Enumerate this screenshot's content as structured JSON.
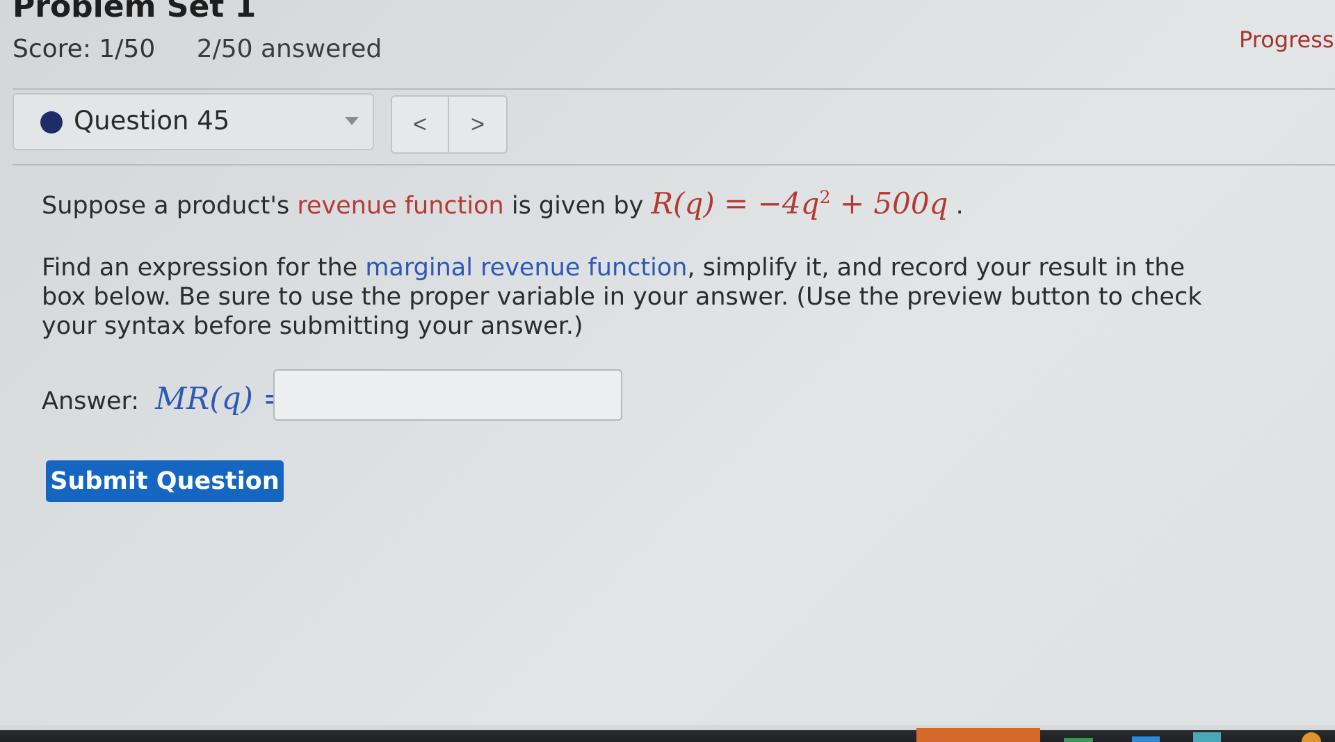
{
  "header": {
    "title": "Problem Set 1",
    "score": "Score: 1/50",
    "answered": "2/50 answered",
    "progress": "Progress saved"
  },
  "question_nav": {
    "selected": "Question 45",
    "prev_label": "<",
    "next_label": ">"
  },
  "question": {
    "p1_intro": "Suppose a product's ",
    "p1_link": "revenue function",
    "p1_mid": " is given by ",
    "p1_formula_lhs": "R(q) = −4q",
    "p1_formula_exp": "2",
    "p1_formula_rhs": " + 500q",
    "p1_end": " .",
    "p2_intro": "Find an expression for the ",
    "p2_link": "marginal revenue function",
    "p2_rest": ", simplify it, and record your result in the box below. Be sure to use the proper variable in your answer. (Use the preview button to check your syntax before submitting your answer.)"
  },
  "answer": {
    "label": "Answer:",
    "expression": "MR(q) =",
    "value": "",
    "placeholder": ""
  },
  "submit_label": "Submit Question",
  "colors": {
    "accent_blue": "#1566c0",
    "link_red": "#b53a34",
    "link_blue": "#2d58b4",
    "status_dot": "#1f2c6a"
  }
}
